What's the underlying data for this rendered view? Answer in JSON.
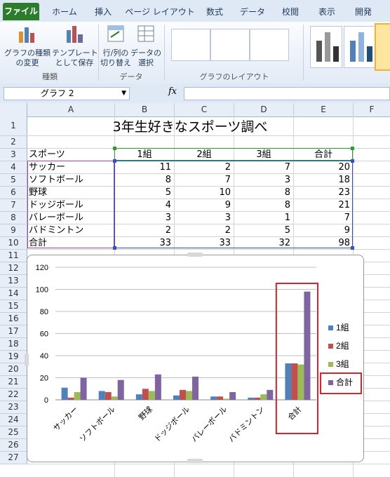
{
  "ribbon": {
    "tabs": [
      {
        "label": "ファイル",
        "active": true
      },
      {
        "label": "ホーム"
      },
      {
        "label": "挿入"
      },
      {
        "label": "ページ レイアウト"
      },
      {
        "label": "数式"
      },
      {
        "label": "データ"
      },
      {
        "label": "校閲"
      },
      {
        "label": "表示"
      },
      {
        "label": "開発"
      }
    ],
    "buttons": {
      "change_chart_type": "グラフの種類\nの変更",
      "save_template": "テンプレート\nとして保存",
      "switch_row_col": "行/列の\n切り替え",
      "select_data": "データの\n選択"
    },
    "groups": {
      "type": "種類",
      "data": "データ",
      "layout": "グラフのレイアウト"
    }
  },
  "formula_bar": {
    "name_box": "グラフ 2",
    "fx": "fx"
  },
  "sheet": {
    "columns": [
      "A",
      "B",
      "C",
      "D",
      "E",
      "F"
    ],
    "rows": [
      "1",
      "2",
      "3",
      "4",
      "5",
      "6",
      "7",
      "8",
      "9",
      "10",
      "11",
      "12",
      "13",
      "14",
      "15",
      "16",
      "17",
      "18",
      "19",
      "20",
      "21",
      "22",
      "23",
      "24",
      "25",
      "26",
      "27"
    ],
    "title": "3年生好きなスポーツ調べ",
    "header": [
      "スポーツ",
      "1組",
      "2組",
      "3組",
      "合計"
    ],
    "data": [
      [
        "サッカー",
        "11",
        "2",
        "7",
        "20"
      ],
      [
        "ソフトボール",
        "8",
        "7",
        "3",
        "18"
      ],
      [
        "野球",
        "5",
        "10",
        "8",
        "23"
      ],
      [
        "ドッジボール",
        "4",
        "9",
        "8",
        "21"
      ],
      [
        "バレーボール",
        "3",
        "3",
        "1",
        "7"
      ],
      [
        "バドミントン",
        "2",
        "2",
        "5",
        "9"
      ],
      [
        "合計",
        "33",
        "33",
        "32",
        "98"
      ]
    ]
  },
  "chart_data": {
    "type": "bar",
    "categories": [
      "サッカー",
      "ソフトボール",
      "野球",
      "ドッジボール",
      "バレーボール",
      "バドミントン",
      "合計"
    ],
    "series": [
      {
        "name": "1組",
        "values": [
          11,
          8,
          5,
          4,
          3,
          2,
          33
        ],
        "color": "#4f81bd"
      },
      {
        "name": "2組",
        "values": [
          2,
          7,
          10,
          9,
          3,
          2,
          33
        ],
        "color": "#c0504d"
      },
      {
        "name": "3組",
        "values": [
          7,
          3,
          8,
          8,
          1,
          5,
          32
        ],
        "color": "#9bbb59"
      },
      {
        "name": "合計",
        "values": [
          20,
          18,
          23,
          21,
          7,
          9,
          98
        ],
        "color": "#8064a2"
      }
    ],
    "yticks": [
      "0",
      "20",
      "40",
      "60",
      "80",
      "100",
      "120"
    ],
    "ylim": [
      0,
      120
    ],
    "grid": true,
    "legend": "right",
    "highlight_color": "#e0202a"
  }
}
